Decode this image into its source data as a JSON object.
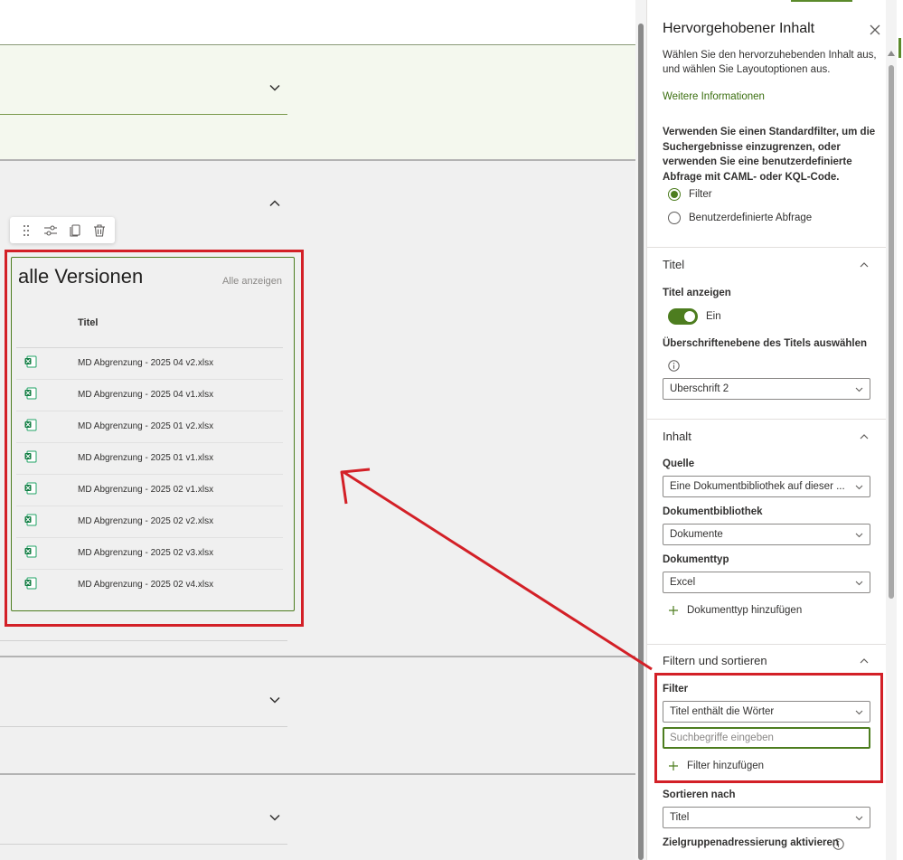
{
  "canvas": {
    "webpart": {
      "title": "alle Versionen",
      "show_all": "Alle anzeigen",
      "column_header": "Titel",
      "files": [
        {
          "name": "MD Abgrenzung - 2025 04 v2.xlsx",
          "icon": "excel-file-icon"
        },
        {
          "name": "MD Abgrenzung - 2025 04 v1.xlsx",
          "icon": "excel-file-icon"
        },
        {
          "name": "MD Abgrenzung - 2025 01 v2.xlsx",
          "icon": "excel-file-icon"
        },
        {
          "name": "MD Abgrenzung - 2025 01 v1.xlsx",
          "icon": "excel-file-icon"
        },
        {
          "name": "MD Abgrenzung - 2025 02 v1.xlsx",
          "icon": "excel-file-icon"
        },
        {
          "name": "MD Abgrenzung - 2025 02 v2.xlsx",
          "icon": "excel-file-icon"
        },
        {
          "name": "MD Abgrenzung - 2025 02 v3.xlsx",
          "icon": "excel-file-icon"
        },
        {
          "name": "MD Abgrenzung - 2025 02 v4.xlsx",
          "icon": "excel-file-icon"
        }
      ]
    },
    "toolbar": {
      "icons": [
        "drag-handle-icon",
        "edit-properties-icon",
        "duplicate-icon",
        "delete-icon"
      ]
    }
  },
  "pane": {
    "title": "Hervorgehobener Inhalt",
    "description": "Wählen Sie den hervorzuhebenden Inhalt aus, und wählen Sie Layoutoptionen aus.",
    "more_info_link": "Weitere Informationen",
    "filter_info": "Verwenden Sie einen Standardfilter, um die Suchergebnisse einzugrenzen, oder verwenden Sie eine benutzerdefinierte Abfrage mit CAML- oder KQL-Code.",
    "radio_filter": "Filter",
    "radio_custom": "Benutzerdefinierte Abfrage",
    "groups": {
      "title": {
        "heading": "Titel",
        "show_title_label": "Titel anzeigen",
        "toggle_state": "Ein",
        "heading_level_label": "Überschriftenebene des Titels auswählen",
        "heading_level_value": "Überschrift 2"
      },
      "content": {
        "heading": "Inhalt",
        "source_label": "Quelle",
        "source_value": "Eine Dokumentbibliothek auf dieser ...",
        "library_label": "Dokumentbibliothek",
        "library_value": "Dokumente",
        "doctype_label": "Dokumenttyp",
        "doctype_value": "Excel",
        "add_doctype": "Dokumenttyp hinzufügen"
      },
      "filter_sort": {
        "heading": "Filtern und sortieren",
        "filter_label": "Filter",
        "filter_value": "Titel enthält die Wörter",
        "search_placeholder": "Suchbegriffe eingeben",
        "add_filter": "Filter hinzufügen",
        "sort_label": "Sortieren nach",
        "sort_value": "Titel",
        "audience_label": "Zielgruppenadressierung aktivieren"
      }
    }
  },
  "colors": {
    "accent": "#4d7d1f",
    "annotation": "#d32027"
  }
}
